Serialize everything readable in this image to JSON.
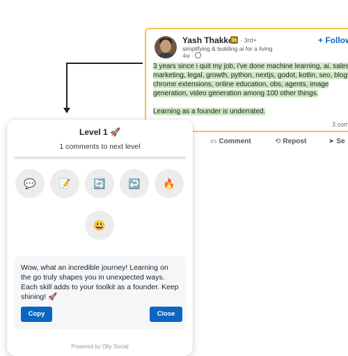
{
  "post": {
    "author": "Yash Thakker",
    "badge": "in",
    "degree": "· 3rd+",
    "headline": "simplifying & building ai for a living",
    "time": "4w ·",
    "follow": "+ Follow",
    "paragraph1": "3 years since i quit my job, i've done machine learning, ai, sales, marketing, legal, growth, python, nextjs, godot, kotlin, seo, blogs, chrome extensions, online education, obs, agents, image generation, video generation among 100 other things.",
    "paragraph2": "Learning as a founder is underrated.",
    "comments_count": "3 com",
    "actions": {
      "comment": "Comment",
      "repost": "Repost",
      "send": "Se"
    }
  },
  "panel": {
    "title": "Level 1 🚀",
    "subtitle": "1 comments to next level",
    "progress": 0.0,
    "tones": [
      "💬",
      "📝",
      "🔄",
      "↩️",
      "🔥",
      "😃"
    ],
    "suggestion": "Wow, what an incredible journey! Learning on the go truly shapes you in unexpected ways. Each skill adds to your toolkit as a founder. Keep shining! 🚀",
    "copy_label": "Copy",
    "close_label": "Close",
    "powered_by": "Powered by Olly Social"
  }
}
